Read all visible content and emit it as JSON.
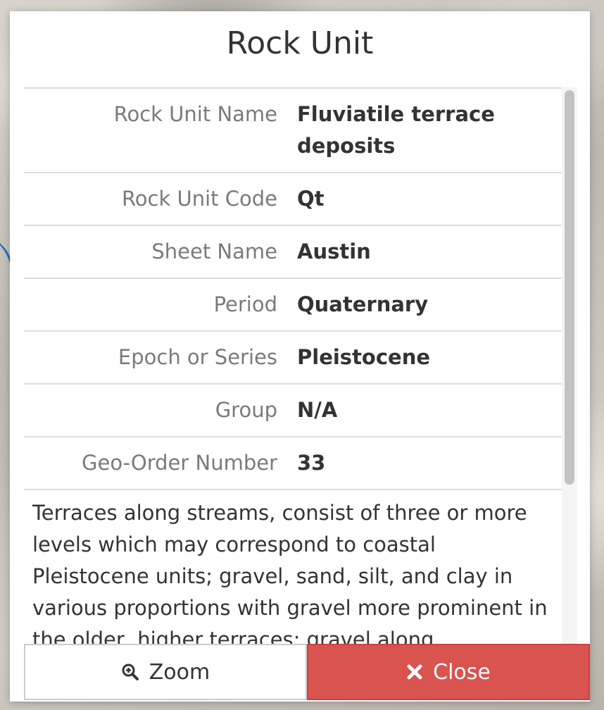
{
  "modal": {
    "title": "Rock Unit",
    "rows": [
      {
        "label": "Rock Unit Name",
        "value": "Fluviatile terrace deposits"
      },
      {
        "label": "Rock Unit Code",
        "value": "Qt"
      },
      {
        "label": "Sheet Name",
        "value": "Austin"
      },
      {
        "label": "Period",
        "value": "Quaternary"
      },
      {
        "label": "Epoch or Series",
        "value": "Pleistocene"
      },
      {
        "label": "Group",
        "value": "N/A"
      },
      {
        "label": "Geo-Order Number",
        "value": "33"
      }
    ],
    "description": "Terraces along streams, consist of three or more levels which may correspond to coastal Pleistocene units; gravel, sand, silt, and clay in various proportions with gravel more prominent in the older, higher terraces; gravel along",
    "buttons": {
      "zoom_label": "Zoom",
      "zoom_icon": "zoom-in-icon",
      "close_label": "Close",
      "close_icon": "close-icon"
    }
  },
  "colors": {
    "close_button": "#d9534f",
    "label_text": "#7a7a7a",
    "value_text": "#333333",
    "map_line": "#1a6fc2"
  }
}
